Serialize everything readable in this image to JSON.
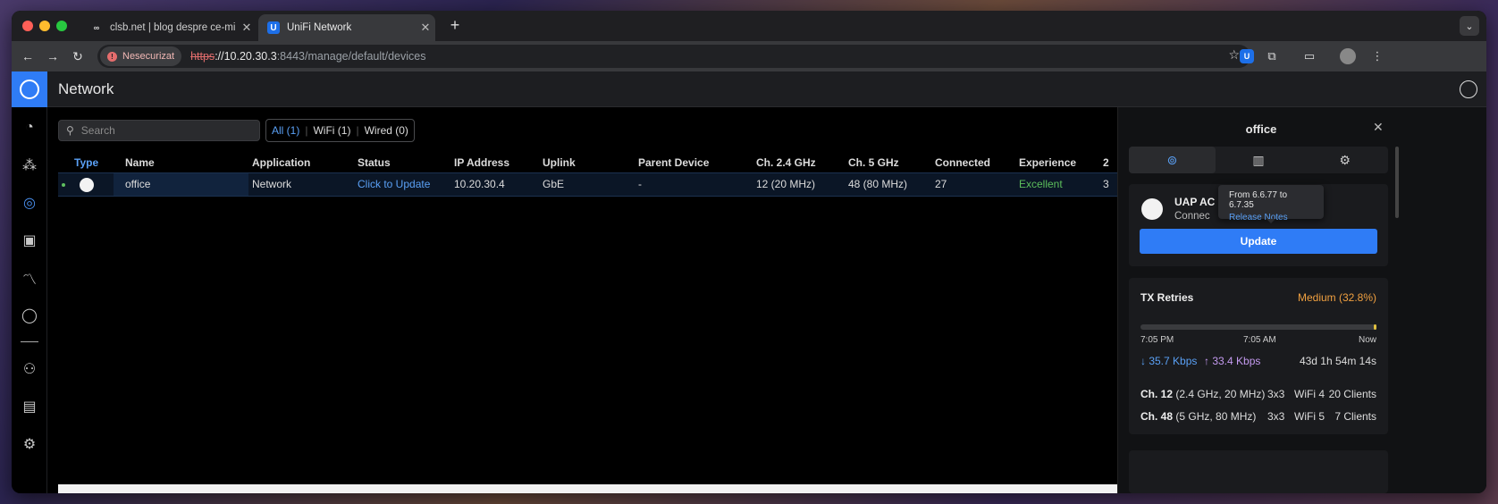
{
  "browser": {
    "tabs": [
      {
        "favicon": "∞",
        "title": "clsb.net | blog despre ce-mi c..."
      },
      {
        "favicon": "U",
        "title": "UniFi Network"
      }
    ],
    "address": {
      "security_label": "Nesecurizat",
      "url_proto": "https",
      "url_host": "://10.20.30.3",
      "url_rest": ":8443/manage/default/devices"
    }
  },
  "app": {
    "title": "Network"
  },
  "toolbar": {
    "search_placeholder": "Search",
    "filters": [
      {
        "label": "All (1)",
        "active": true
      },
      {
        "label": "WiFi (1)",
        "active": false
      },
      {
        "label": "Wired (0)",
        "active": false
      }
    ]
  },
  "table": {
    "headers": [
      "Type",
      "Name",
      "Application",
      "Status",
      "IP Address",
      "Uplink",
      "Parent Device",
      "Ch. 2.4 GHz",
      "Ch. 5 GHz",
      "Connected",
      "Experience",
      "2"
    ],
    "rows": [
      {
        "name": "office",
        "application": "Network",
        "status": "Click to Update",
        "ip": "10.20.30.4",
        "uplink": "GbE",
        "parent": "-",
        "ch24": "12 (20 MHz)",
        "ch5": "48 (80 MHz)",
        "connected": "27",
        "experience": "Excellent",
        "extra": "3"
      }
    ]
  },
  "panel": {
    "title": "office",
    "device": {
      "model": "UAP AC",
      "status": "Connec",
      "tooltip_version": "From 6.6.77 to 6.7.35",
      "tooltip_link": "Release Notes",
      "update_label": "Update"
    },
    "tx": {
      "label": "TX Retries",
      "value": "Medium (32.8%)",
      "times": [
        "7:05 PM",
        "7:05 AM",
        "Now"
      ],
      "down": "↓ 35.7 Kbps",
      "up": "↑ 33.4 Kbps",
      "uptime": "43d 1h 54m 14s"
    },
    "radios": [
      {
        "ch": "Ch. 12",
        "detail": "(2.4 GHz, 20 MHz)",
        "mimo": "3x3",
        "wifi": "WiFi 4",
        "clients": "20 Clients"
      },
      {
        "ch": "Ch. 48",
        "detail": "(5 GHz, 80 MHz)",
        "mimo": "3x3",
        "wifi": "WiFi 5",
        "clients": "7 Clients"
      }
    ]
  },
  "colors": {
    "accent": "#2f7cf6",
    "link": "#5aa0f5",
    "good": "#5cbf5c",
    "warning": "#f0a040"
  }
}
